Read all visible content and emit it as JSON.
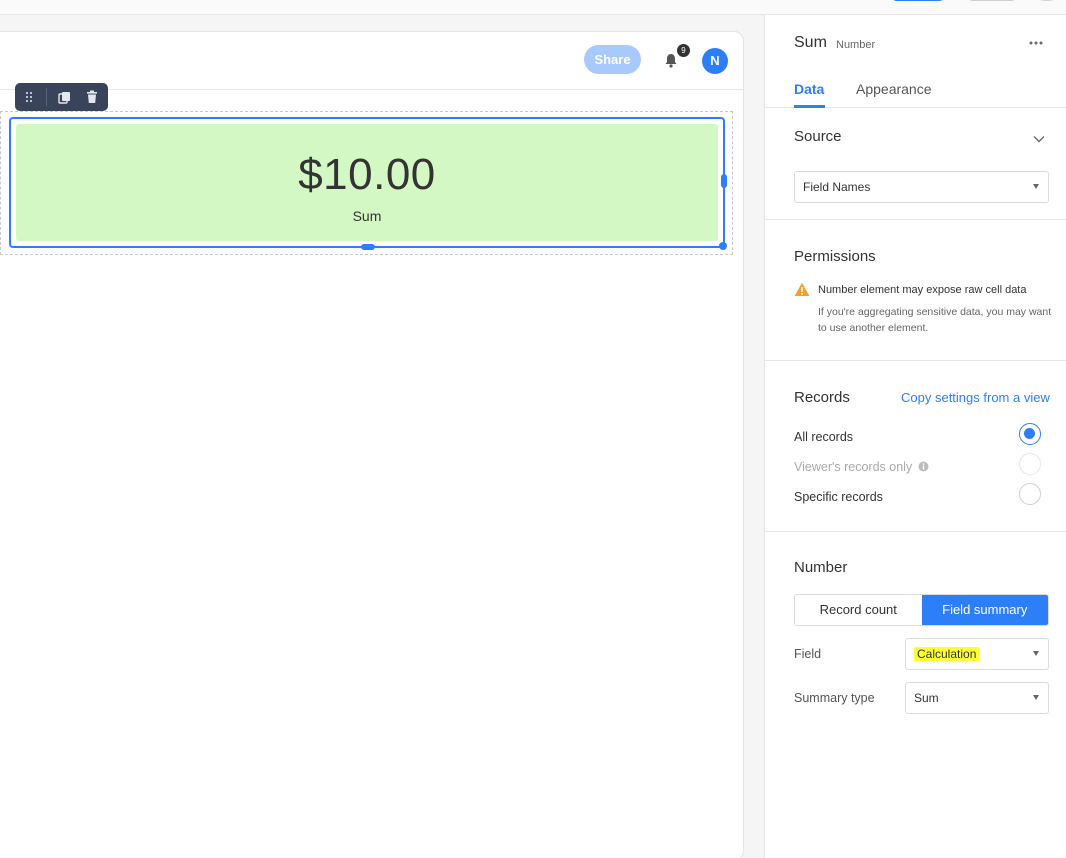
{
  "canvas": {
    "share_label": "Share",
    "notification_count": "9",
    "avatar_initial": "N",
    "element": {
      "value": "$10.00",
      "label": "Sum",
      "background_color": "#d3f8c4"
    }
  },
  "panel": {
    "title": "Sum",
    "subtitle": "Number",
    "tabs": [
      {
        "label": "Data",
        "active": true
      },
      {
        "label": "Appearance",
        "active": false
      }
    ],
    "source": {
      "title": "Source",
      "selected": "Field Names"
    },
    "permissions": {
      "title": "Permissions",
      "warning_title": "Number element may expose raw cell data",
      "warning_text": "If you're aggregating sensitive data, you may want to use another element."
    },
    "records": {
      "title": "Records",
      "copy_link": "Copy settings from a view",
      "options": [
        {
          "label": "All records",
          "checked": true,
          "disabled": false
        },
        {
          "label": "Viewer's records only",
          "checked": false,
          "disabled": true
        },
        {
          "label": "Specific records",
          "checked": false,
          "disabled": false
        }
      ]
    },
    "number": {
      "title": "Number",
      "modes": [
        {
          "label": "Record count",
          "active": false
        },
        {
          "label": "Field summary",
          "active": true
        }
      ],
      "field_label": "Field",
      "field_value": "Calculation",
      "summary_label": "Summary type",
      "summary_value": "Sum"
    }
  },
  "colors": {
    "accent": "#2d7ff9",
    "toolbar": "#39435a",
    "highlight": "#ffff38",
    "warning": "#f0a030"
  }
}
